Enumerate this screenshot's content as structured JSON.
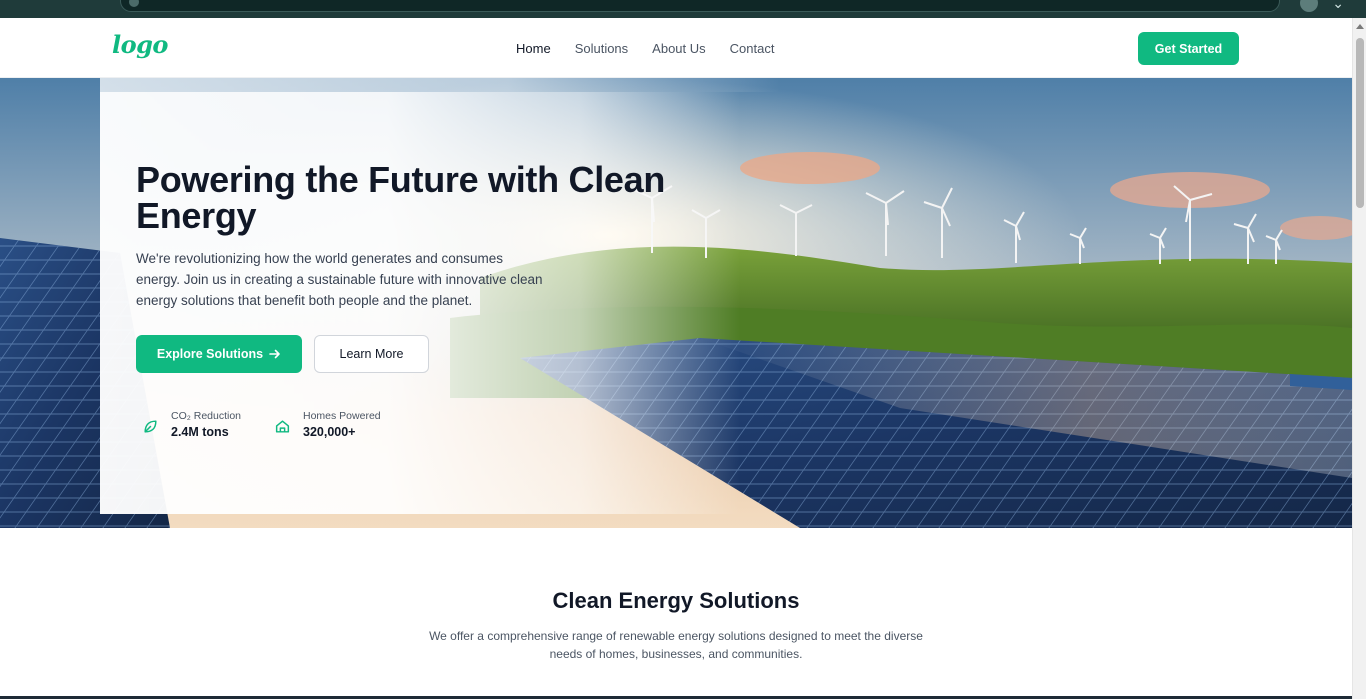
{
  "header": {
    "logo_text": "logo",
    "nav": [
      {
        "label": "Home",
        "active": true
      },
      {
        "label": "Solutions",
        "active": false
      },
      {
        "label": "About Us",
        "active": false
      },
      {
        "label": "Contact",
        "active": false
      }
    ],
    "cta_label": "Get Started"
  },
  "hero": {
    "title": "Powering the Future with Clean Energy",
    "description": "We're revolutionizing how the world generates and consumes energy. Join us in creating a sustainable future with innovative clean energy solutions that benefit both people and the planet.",
    "primary_button": "Explore Solutions",
    "primary_button_icon": "arrow-right-icon",
    "secondary_button": "Learn More",
    "stats": [
      {
        "icon": "leaf-icon",
        "label": "CO₂ Reduction",
        "value": "2.4M tons"
      },
      {
        "icon": "home-icon",
        "label": "Homes Powered",
        "value": "320,000+"
      }
    ]
  },
  "solutions": {
    "title": "Clean Energy Solutions",
    "description": "We offer a comprehensive range of renewable energy solutions designed to meet the diverse needs of homes, businesses, and communities."
  },
  "colors": {
    "accent": "#10b981",
    "text_dark": "#111827",
    "text_muted": "#4b5563"
  }
}
